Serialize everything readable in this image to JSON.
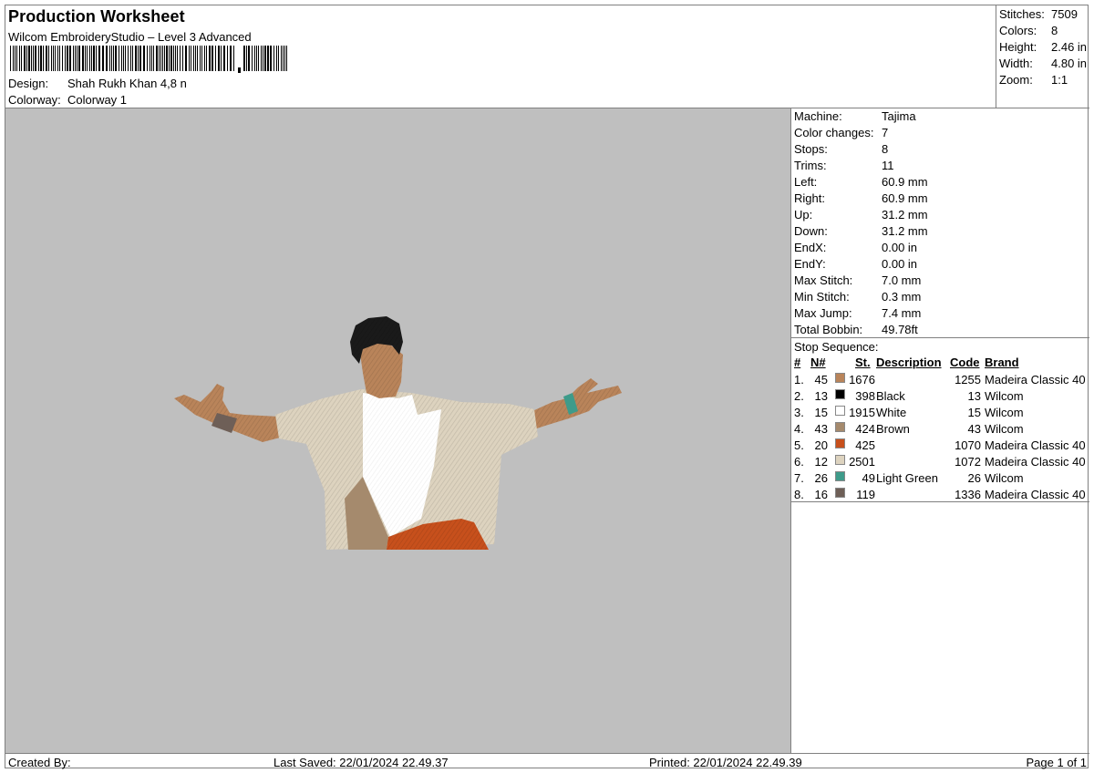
{
  "header": {
    "title": "Production Worksheet",
    "subtitle": "Wilcom EmbroideryStudio – Level 3 Advanced",
    "design_label": "Design:",
    "design_value": "Shah Rukh Khan 4,8 n",
    "colorway_label": "Colorway:",
    "colorway_value": "Colorway 1"
  },
  "stats": [
    {
      "label": "Stitches:",
      "value": "7509"
    },
    {
      "label": "Colors:",
      "value": "8"
    },
    {
      "label": "Height:",
      "value": "2.46 in"
    },
    {
      "label": "Width:",
      "value": "4.80 in"
    },
    {
      "label": "Zoom:",
      "value": "1:1"
    }
  ],
  "machine_info": [
    {
      "label": "Machine:",
      "value": "Tajima"
    },
    {
      "label": "Color changes:",
      "value": "7"
    },
    {
      "label": "Stops:",
      "value": "8"
    },
    {
      "label": "Trims:",
      "value": "11"
    },
    {
      "label": "Left:",
      "value": "60.9 mm"
    },
    {
      "label": "Right:",
      "value": "60.9 mm"
    },
    {
      "label": "Up:",
      "value": "31.2 mm"
    },
    {
      "label": "Down:",
      "value": "31.2 mm"
    },
    {
      "label": "EndX:",
      "value": "0.00 in"
    },
    {
      "label": "EndY:",
      "value": "0.00 in"
    },
    {
      "label": "Max Stitch:",
      "value": "7.0 mm"
    },
    {
      "label": "Min Stitch:",
      "value": "0.3 mm"
    },
    {
      "label": "Max Jump:",
      "value": "7.4 mm"
    },
    {
      "label": "Total Bobbin:",
      "value": "49.78ft"
    }
  ],
  "stop_sequence": {
    "title": "Stop Sequence:",
    "headers": {
      "num": "#",
      "n": "N#",
      "st": "St.",
      "desc": "Description",
      "code": "Code",
      "brand": "Brand"
    },
    "rows": [
      {
        "idx": "1.",
        "n": "45",
        "color": "#b9845a",
        "st": "1676",
        "desc": "",
        "code": "1255",
        "brand": "Madeira Classic 40"
      },
      {
        "idx": "2.",
        "n": "13",
        "color": "#000000",
        "st": "398",
        "desc": "Black",
        "code": "13",
        "brand": "Wilcom"
      },
      {
        "idx": "3.",
        "n": "15",
        "color": "#ffffff",
        "st": "1915",
        "desc": "White",
        "code": "15",
        "brand": "Wilcom"
      },
      {
        "idx": "4.",
        "n": "43",
        "color": "#a58a6d",
        "st": "424",
        "desc": "Brown",
        "code": "43",
        "brand": "Wilcom"
      },
      {
        "idx": "5.",
        "n": "20",
        "color": "#c7501c",
        "st": "425",
        "desc": "",
        "code": "1070",
        "brand": "Madeira Classic 40"
      },
      {
        "idx": "6.",
        "n": "12",
        "color": "#ddd3bf",
        "st": "2501",
        "desc": "",
        "code": "1072",
        "brand": "Madeira Classic 40"
      },
      {
        "idx": "7.",
        "n": "26",
        "color": "#3e9b8a",
        "st": "49",
        "desc": "Light Green",
        "code": "26",
        "brand": "Wilcom"
      },
      {
        "idx": "8.",
        "n": "16",
        "color": "#6e5f57",
        "st": "119",
        "desc": "",
        "code": "1336",
        "brand": "Madeira Classic 40"
      }
    ]
  },
  "footer": {
    "created_by": "Created By:",
    "last_saved": "Last Saved: 22/01/2024 22.49.37",
    "printed": "Printed: 22/01/2024 22.49.39",
    "page": "Page 1 of 1"
  },
  "colors": {
    "preview_bg": "#bfbfbf",
    "border": "#808080"
  }
}
